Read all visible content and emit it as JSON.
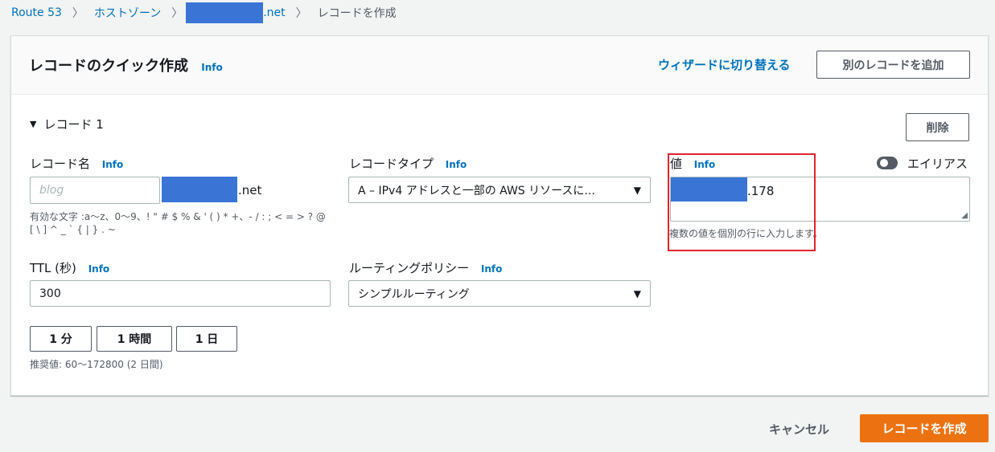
{
  "breadcrumb": {
    "route53": "Route 53",
    "hosted_zones": "ホストゾーン",
    "domain_suffix": ".net",
    "current": "レコードを作成"
  },
  "header": {
    "title": "レコードのクイック作成",
    "info": "Info",
    "wizard_link": "ウィザードに切り替える",
    "add_record_button": "別のレコードを追加"
  },
  "record": {
    "section_title": "レコード 1",
    "delete_button": "削除",
    "name": {
      "label": "レコード名",
      "info": "Info",
      "placeholder": "blog",
      "domain_suffix": ".net",
      "hint_line1": "有効な文字 :a〜z、0〜9、! \" # $ % & ' ( ) * +、- / : ; < = > ? @",
      "hint_line2": "[ \\ ] ^ _ ` { | } . ~"
    },
    "type": {
      "label": "レコードタイプ",
      "info": "Info",
      "value": "A – IPv4 アドレスと一部の AWS リソースに..."
    },
    "value": {
      "label": "値",
      "info": "Info",
      "suffix": ".178",
      "hint": "複数の値を個別の行に入力します。"
    },
    "alias": {
      "label": "エイリアス",
      "enabled": false
    },
    "ttl": {
      "label": "TTL (秒)",
      "info": "Info",
      "value": "300",
      "presets": [
        "1 分",
        "1 時間",
        "1 日"
      ],
      "recommended": "推奨値: 60〜172800 (2 日間)"
    },
    "routing": {
      "label": "ルーティングポリシー",
      "info": "Info",
      "value": "シンプルルーティング"
    }
  },
  "footer": {
    "cancel": "キャンセル",
    "create": "レコードを作成"
  },
  "colors": {
    "primary": "#ec7211",
    "link": "#0073bb",
    "highlight": "#e0242e",
    "redaction": "#3a75d6"
  }
}
